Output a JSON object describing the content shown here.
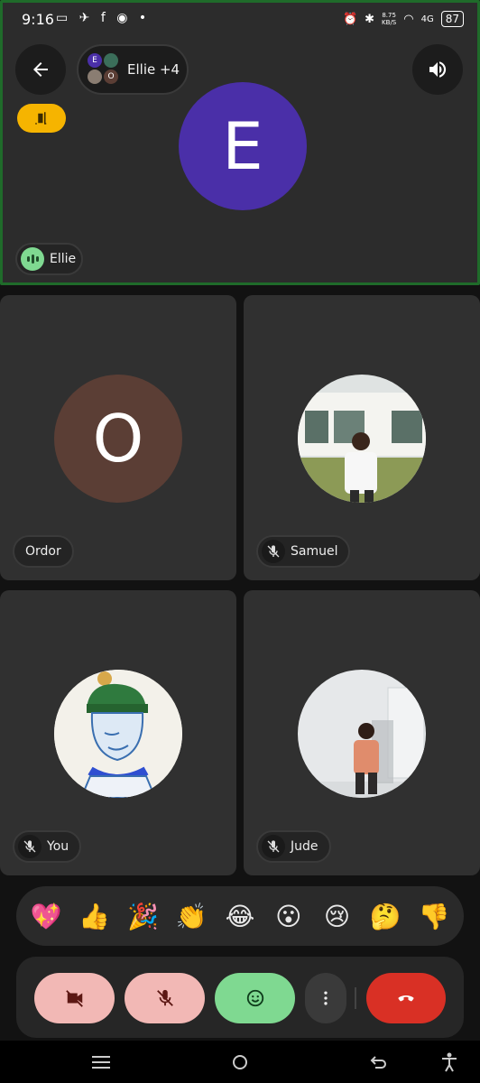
{
  "status_bar": {
    "time": "9:16",
    "left_icons": "▭ ✈ f ◉ •",
    "net_speed": "8.75\nKB/S",
    "network": "4G",
    "battery": "87"
  },
  "top_panel": {
    "participants_label": "Ellie +4",
    "mini_avatar_letters": [
      "E",
      "O"
    ],
    "main_avatar_letter": "E",
    "speaker_name": "Ellie",
    "accent_color": "#4a2fa8",
    "border_color": "#1f6b2a"
  },
  "tiles": [
    {
      "name": "Ordor",
      "avatar_letter": "O",
      "avatar_color": "#5b3e35",
      "muted": false
    },
    {
      "name": "Samuel",
      "avatar_type": "photo",
      "muted": true
    },
    {
      "name": "You",
      "avatar_type": "illustration",
      "muted": true
    },
    {
      "name": "Jude",
      "avatar_type": "photo",
      "muted": true
    }
  ],
  "reactions": [
    "💖",
    "👍",
    "🎉",
    "👏",
    "😂",
    "😮",
    "😢",
    "🤔",
    "👎"
  ],
  "controls": {
    "icons": [
      "video-off-icon",
      "mic-off-icon",
      "emoji-icon",
      "more-vert-icon",
      "call-end-icon"
    ],
    "off_color": "#f2b8b5",
    "emoji_color": "#7fd991",
    "end_color": "#d93025"
  }
}
